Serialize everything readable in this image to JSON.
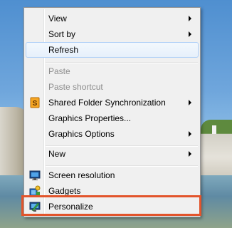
{
  "menu": {
    "view": "View",
    "sort_by": "Sort by",
    "refresh": "Refresh",
    "paste": "Paste",
    "paste_shortcut": "Paste shortcut",
    "shared_folder_sync": "Shared Folder Synchronization",
    "graphics_properties": "Graphics Properties...",
    "graphics_options": "Graphics Options",
    "new": "New",
    "screen_resolution": "Screen resolution",
    "gadgets": "Gadgets",
    "personalize": "Personalize"
  },
  "icons": {
    "shared_folder_sync": "sync-s-icon",
    "screen_resolution": "monitor-icon",
    "gadgets": "gadgets-icon",
    "personalize": "personalize-icon"
  },
  "colors": {
    "highlight_border": "#e2542b",
    "hover_border": "#aecff7",
    "menu_background": "#f0f0f0"
  }
}
